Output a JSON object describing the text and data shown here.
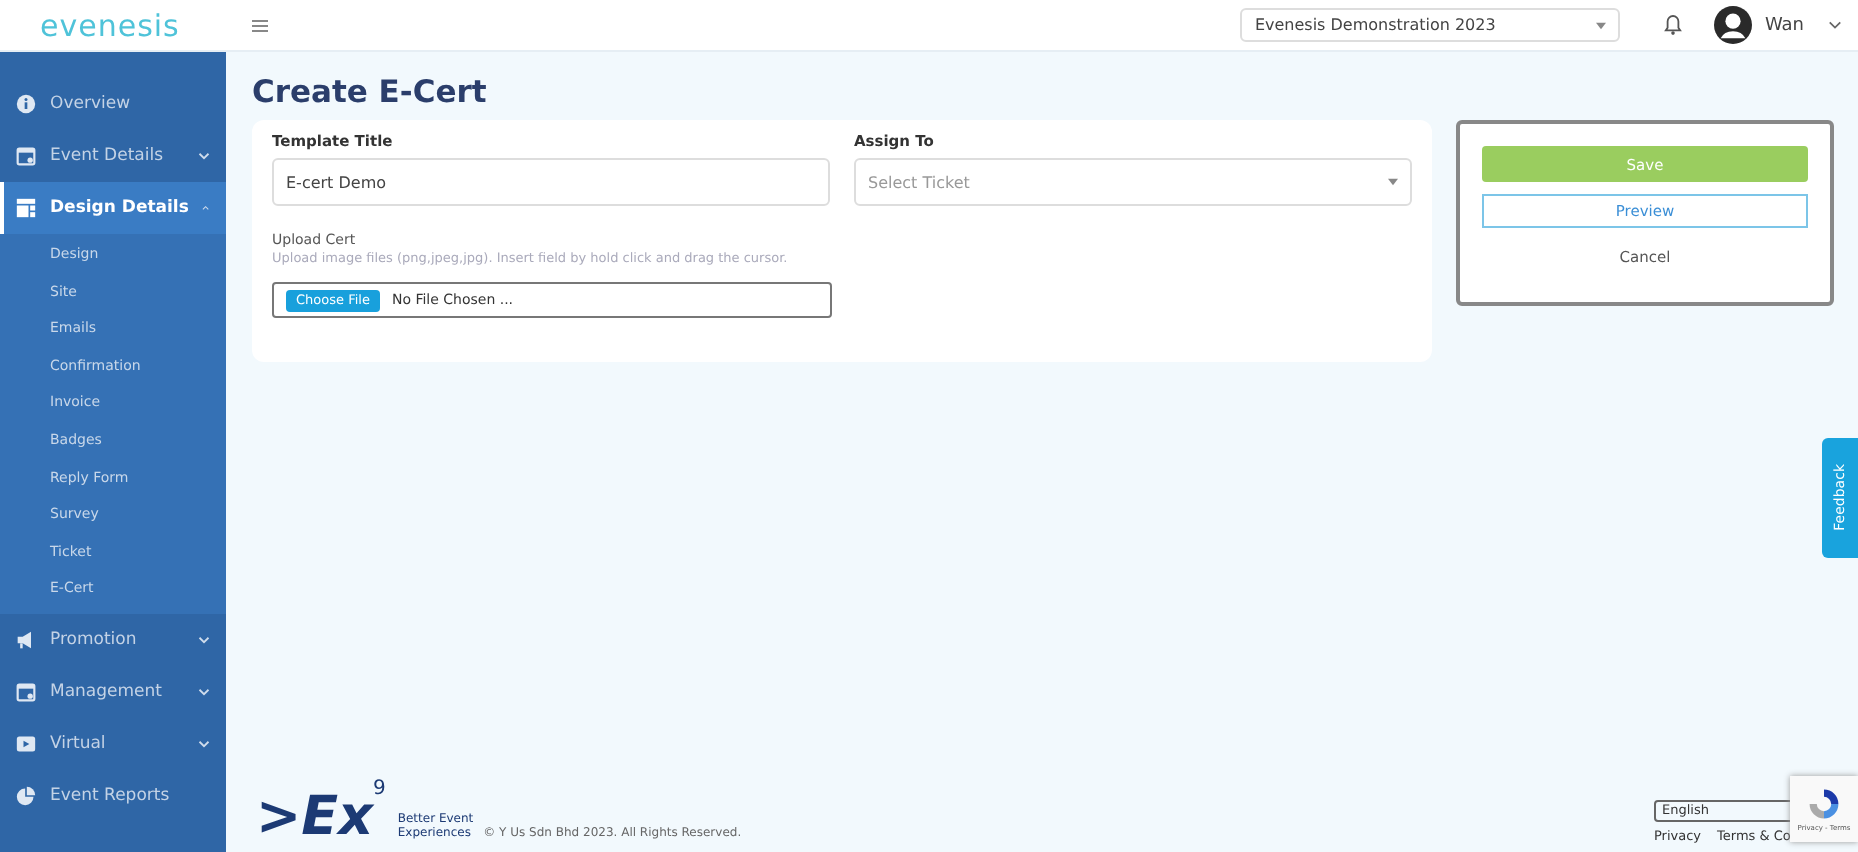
{
  "header": {
    "logo": "evenesis",
    "event_select": "Evenesis Demonstration 2023",
    "user_name": "Wan"
  },
  "sidebar": {
    "items": [
      {
        "label": "Overview",
        "selected": false
      },
      {
        "label": "Event Details",
        "selected": false,
        "expanded": false
      },
      {
        "label": "Design Details",
        "selected": true,
        "expanded": true,
        "children": [
          {
            "label": "Design"
          },
          {
            "label": "Site"
          },
          {
            "label": "Emails"
          },
          {
            "label": "Confirmation"
          },
          {
            "label": "Invoice"
          },
          {
            "label": "Badges"
          },
          {
            "label": "Reply Form"
          },
          {
            "label": "Survey"
          },
          {
            "label": "Ticket"
          },
          {
            "label": "E-Cert"
          }
        ]
      },
      {
        "label": "Promotion",
        "selected": false,
        "expanded": false
      },
      {
        "label": "Management",
        "selected": false,
        "expanded": false
      },
      {
        "label": "Virtual",
        "selected": false,
        "expanded": false
      },
      {
        "label": "Event Reports",
        "selected": false
      }
    ]
  },
  "page_title": "Create E-Cert",
  "form": {
    "template_title": {
      "label": "Template Title",
      "value": "E-cert Demo"
    },
    "assign_to": {
      "label": "Assign To",
      "placeholder": "Select Ticket"
    },
    "upload": {
      "label": "Upload Cert",
      "hint": "Upload image files (png,jpeg,jpg). Insert field by hold click and drag the cursor.",
      "button": "Choose File",
      "status": "No File Chosen ..."
    }
  },
  "actions": {
    "save": "Save",
    "preview": "Preview",
    "cancel": "Cancel"
  },
  "feedback_tab": "Feedback",
  "footer": {
    "logo_text": ">Ex",
    "logo_sup": "9",
    "tagline_1": "Better Event",
    "tagline_2": "Experiences",
    "copyright": "© Y Us Sdn Bhd 2023. All Rights Reserved.",
    "language": "English",
    "links": [
      "Privacy",
      "Terms & Co"
    ],
    "recaptcha": "Privacy - Terms"
  }
}
